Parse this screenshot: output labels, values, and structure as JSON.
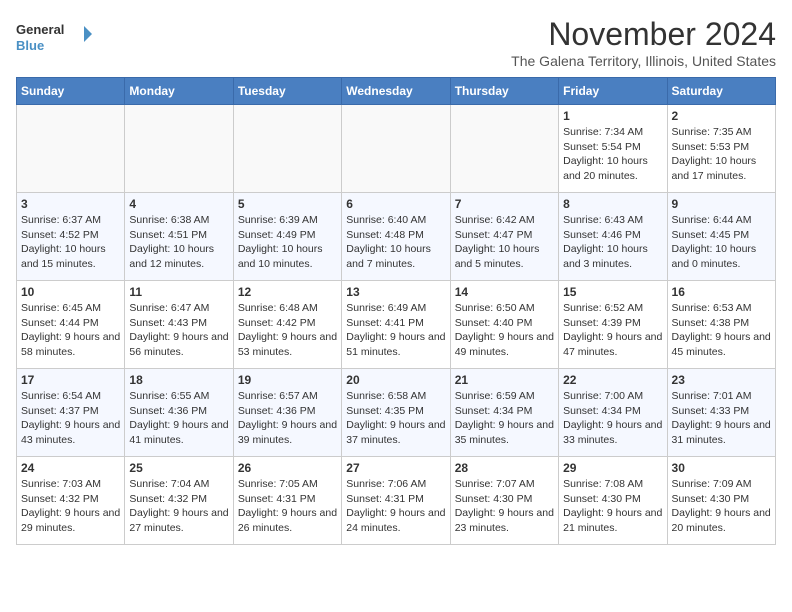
{
  "header": {
    "logo_line1": "General",
    "logo_line2": "Blue",
    "month_title": "November 2024",
    "subtitle": "The Galena Territory, Illinois, United States"
  },
  "weekdays": [
    "Sunday",
    "Monday",
    "Tuesday",
    "Wednesday",
    "Thursday",
    "Friday",
    "Saturday"
  ],
  "weeks": [
    [
      {
        "day": "",
        "info": ""
      },
      {
        "day": "",
        "info": ""
      },
      {
        "day": "",
        "info": ""
      },
      {
        "day": "",
        "info": ""
      },
      {
        "day": "",
        "info": ""
      },
      {
        "day": "1",
        "info": "Sunrise: 7:34 AM\nSunset: 5:54 PM\nDaylight: 10 hours and 20 minutes."
      },
      {
        "day": "2",
        "info": "Sunrise: 7:35 AM\nSunset: 5:53 PM\nDaylight: 10 hours and 17 minutes."
      }
    ],
    [
      {
        "day": "3",
        "info": "Sunrise: 6:37 AM\nSunset: 4:52 PM\nDaylight: 10 hours and 15 minutes."
      },
      {
        "day": "4",
        "info": "Sunrise: 6:38 AM\nSunset: 4:51 PM\nDaylight: 10 hours and 12 minutes."
      },
      {
        "day": "5",
        "info": "Sunrise: 6:39 AM\nSunset: 4:49 PM\nDaylight: 10 hours and 10 minutes."
      },
      {
        "day": "6",
        "info": "Sunrise: 6:40 AM\nSunset: 4:48 PM\nDaylight: 10 hours and 7 minutes."
      },
      {
        "day": "7",
        "info": "Sunrise: 6:42 AM\nSunset: 4:47 PM\nDaylight: 10 hours and 5 minutes."
      },
      {
        "day": "8",
        "info": "Sunrise: 6:43 AM\nSunset: 4:46 PM\nDaylight: 10 hours and 3 minutes."
      },
      {
        "day": "9",
        "info": "Sunrise: 6:44 AM\nSunset: 4:45 PM\nDaylight: 10 hours and 0 minutes."
      }
    ],
    [
      {
        "day": "10",
        "info": "Sunrise: 6:45 AM\nSunset: 4:44 PM\nDaylight: 9 hours and 58 minutes."
      },
      {
        "day": "11",
        "info": "Sunrise: 6:47 AM\nSunset: 4:43 PM\nDaylight: 9 hours and 56 minutes."
      },
      {
        "day": "12",
        "info": "Sunrise: 6:48 AM\nSunset: 4:42 PM\nDaylight: 9 hours and 53 minutes."
      },
      {
        "day": "13",
        "info": "Sunrise: 6:49 AM\nSunset: 4:41 PM\nDaylight: 9 hours and 51 minutes."
      },
      {
        "day": "14",
        "info": "Sunrise: 6:50 AM\nSunset: 4:40 PM\nDaylight: 9 hours and 49 minutes."
      },
      {
        "day": "15",
        "info": "Sunrise: 6:52 AM\nSunset: 4:39 PM\nDaylight: 9 hours and 47 minutes."
      },
      {
        "day": "16",
        "info": "Sunrise: 6:53 AM\nSunset: 4:38 PM\nDaylight: 9 hours and 45 minutes."
      }
    ],
    [
      {
        "day": "17",
        "info": "Sunrise: 6:54 AM\nSunset: 4:37 PM\nDaylight: 9 hours and 43 minutes."
      },
      {
        "day": "18",
        "info": "Sunrise: 6:55 AM\nSunset: 4:36 PM\nDaylight: 9 hours and 41 minutes."
      },
      {
        "day": "19",
        "info": "Sunrise: 6:57 AM\nSunset: 4:36 PM\nDaylight: 9 hours and 39 minutes."
      },
      {
        "day": "20",
        "info": "Sunrise: 6:58 AM\nSunset: 4:35 PM\nDaylight: 9 hours and 37 minutes."
      },
      {
        "day": "21",
        "info": "Sunrise: 6:59 AM\nSunset: 4:34 PM\nDaylight: 9 hours and 35 minutes."
      },
      {
        "day": "22",
        "info": "Sunrise: 7:00 AM\nSunset: 4:34 PM\nDaylight: 9 hours and 33 minutes."
      },
      {
        "day": "23",
        "info": "Sunrise: 7:01 AM\nSunset: 4:33 PM\nDaylight: 9 hours and 31 minutes."
      }
    ],
    [
      {
        "day": "24",
        "info": "Sunrise: 7:03 AM\nSunset: 4:32 PM\nDaylight: 9 hours and 29 minutes."
      },
      {
        "day": "25",
        "info": "Sunrise: 7:04 AM\nSunset: 4:32 PM\nDaylight: 9 hours and 27 minutes."
      },
      {
        "day": "26",
        "info": "Sunrise: 7:05 AM\nSunset: 4:31 PM\nDaylight: 9 hours and 26 minutes."
      },
      {
        "day": "27",
        "info": "Sunrise: 7:06 AM\nSunset: 4:31 PM\nDaylight: 9 hours and 24 minutes."
      },
      {
        "day": "28",
        "info": "Sunrise: 7:07 AM\nSunset: 4:30 PM\nDaylight: 9 hours and 23 minutes."
      },
      {
        "day": "29",
        "info": "Sunrise: 7:08 AM\nSunset: 4:30 PM\nDaylight: 9 hours and 21 minutes."
      },
      {
        "day": "30",
        "info": "Sunrise: 7:09 AM\nSunset: 4:30 PM\nDaylight: 9 hours and 20 minutes."
      }
    ]
  ]
}
